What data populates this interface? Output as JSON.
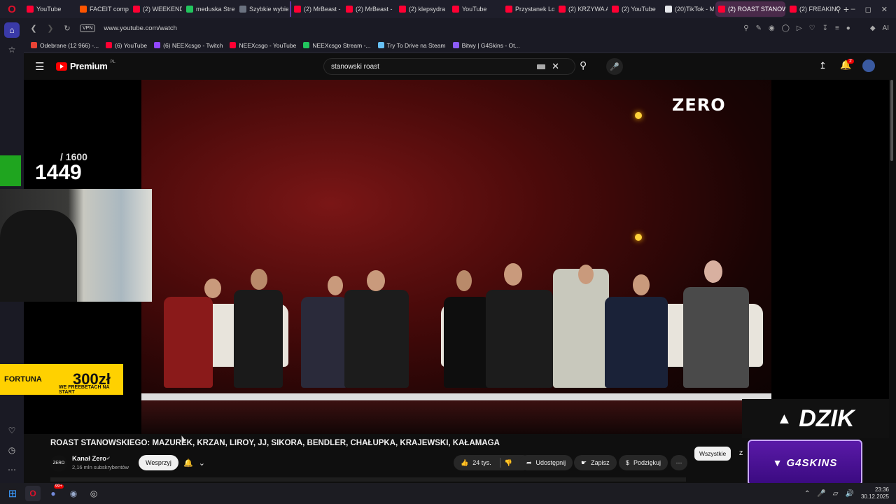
{
  "browser": {
    "tabs": [
      {
        "label": "YouTube",
        "color": "#ff0033"
      },
      {
        "label": "FACEIT compe",
        "color": "#ff5500"
      },
      {
        "label": "(2) WEEKEND",
        "color": "#ff0033"
      },
      {
        "label": "meduska Stre",
        "color": "#22c55e"
      },
      {
        "label": "Szybkie wybie",
        "color": "#6b7280"
      },
      {
        "label": "(2) MrBeast -",
        "color": "#ff0033"
      },
      {
        "label": "(2) MrBeast -",
        "color": "#ff0033"
      },
      {
        "label": "(2) klepsydra",
        "color": "#ff0033"
      },
      {
        "label": "YouTube",
        "color": "#ff0033"
      },
      {
        "label": "Przystanek Lo",
        "color": "#ff0033"
      },
      {
        "label": "(2) KRZYWA A",
        "color": "#ff0033"
      },
      {
        "label": "(2) YouTube",
        "color": "#ff0033"
      },
      {
        "label": "(20)TikTok - M",
        "color": "#e5e7eb"
      },
      {
        "label": "(2) ROAST STANOW",
        "color": "#ff0033",
        "active": true
      },
      {
        "label": "(2) FREAKING",
        "color": "#ff0033"
      }
    ],
    "new_tab": "+",
    "url": "www.youtube.com/watch",
    "vpn_label": "VPN",
    "ai_label": "AI",
    "bookmarks": [
      {
        "label": "Odebrane (12 966) -...",
        "color": "#ea4335"
      },
      {
        "label": "(6) YouTube",
        "color": "#ff0033"
      },
      {
        "label": "(6) NEEXcsgo - Twitch",
        "color": "#9146ff"
      },
      {
        "label": "NEEXcsgo - YouTube",
        "color": "#ff0033"
      },
      {
        "label": "NEEXcsgo Stream -...",
        "color": "#22c55e"
      },
      {
        "label": "Try To Drive na Steam",
        "color": "#66c0f4"
      },
      {
        "label": "Bitwy | G4Skins - Ot...",
        "color": "#8b5cf6"
      }
    ]
  },
  "youtube": {
    "brand": "Premium",
    "region": "PL",
    "search_value": "stanowski roast",
    "notification_count": "2"
  },
  "video": {
    "channel_watermark": "ZERO",
    "counter_max": "/ 1600",
    "counter_value": "1449",
    "promo": {
      "fortuna_name": "FORTUNA",
      "fortuna_amount": "300zł",
      "fortuna_sub": "WE FREEBETACH NA START"
    },
    "dzik": "DZIK",
    "g4skins": "G4SKINS"
  },
  "info": {
    "title": "ROAST STANOWSKIEGO: MAZUREK, KRZAN, LIROY, JJ, SIKORA, BENDLER, CHAŁUPKA, KRAJEWSKI, KAŁAMAGA",
    "channel_logo": "ZERO",
    "channel_name": "Kanał Zero",
    "subscribers": "2,16 mln subskrybentów",
    "support_button": "Wesprzyj",
    "likes": "24 tys.",
    "share": "Udostępnij",
    "save": "Zapisz",
    "thanks": "Podziękuj",
    "chip_all": "Wszystkie",
    "chip_next": "Z"
  },
  "taskbar": {
    "discord_badge": "99+",
    "time": "23:36",
    "date": "30.12.2025"
  },
  "colors": {
    "yt_red": "#ff0000",
    "fortuna_yellow": "#ffd100",
    "g4skins_purple": "#5a1aa8",
    "active_tab": "#4a2a4a"
  }
}
